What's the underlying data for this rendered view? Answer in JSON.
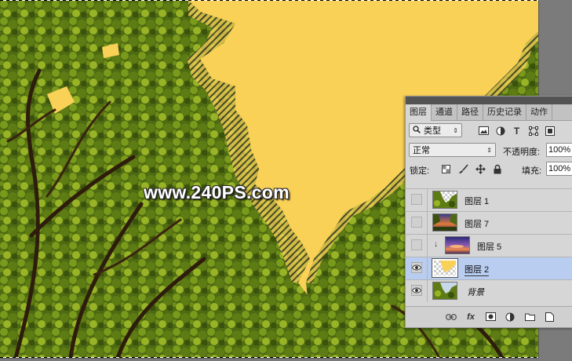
{
  "watermark": "www.240PS.com",
  "colors": {
    "fill": "#fad157",
    "selection": "#b8cdf0",
    "panel": "#d6d6d6"
  },
  "panel": {
    "tabs": [
      "图层",
      "通道",
      "路径",
      "历史记录",
      "动作"
    ],
    "active_tab": "图层",
    "filter": {
      "value": "类型",
      "icons": [
        "image-icon",
        "adjustment-icon",
        "type-icon",
        "shape-icon",
        "smart-object-icon"
      ]
    },
    "blend_mode": "正常",
    "opacity": {
      "label": "不透明度:",
      "value": "100%"
    },
    "lock": {
      "label": "锁定:",
      "icons": [
        "lock-transparency-icon",
        "lock-paint-icon",
        "lock-position-icon",
        "lock-all-icon"
      ]
    },
    "fill": {
      "label": "填充:",
      "value": "100%"
    },
    "layers": [
      {
        "name": "图层 1",
        "visible": false,
        "clipped": false,
        "selected": false,
        "thumb": "trees-transparent"
      },
      {
        "name": "图层 7",
        "visible": false,
        "clipped": false,
        "selected": false,
        "thumb": "sunset-trees"
      },
      {
        "name": "图层 5",
        "visible": false,
        "clipped": true,
        "selected": false,
        "thumb": "sky"
      },
      {
        "name": "图层 2",
        "visible": true,
        "clipped": false,
        "selected": true,
        "thumb": "yellow-transparent"
      },
      {
        "name": "背景",
        "visible": true,
        "clipped": false,
        "selected": false,
        "thumb": "trees-photo"
      }
    ],
    "bottom_icons": [
      "link-icon",
      "fx-icon",
      "add-mask-icon",
      "adjustment-layer-icon",
      "new-group-icon",
      "new-layer-icon"
    ],
    "bottom_labels": {
      "fx": "fx"
    }
  }
}
